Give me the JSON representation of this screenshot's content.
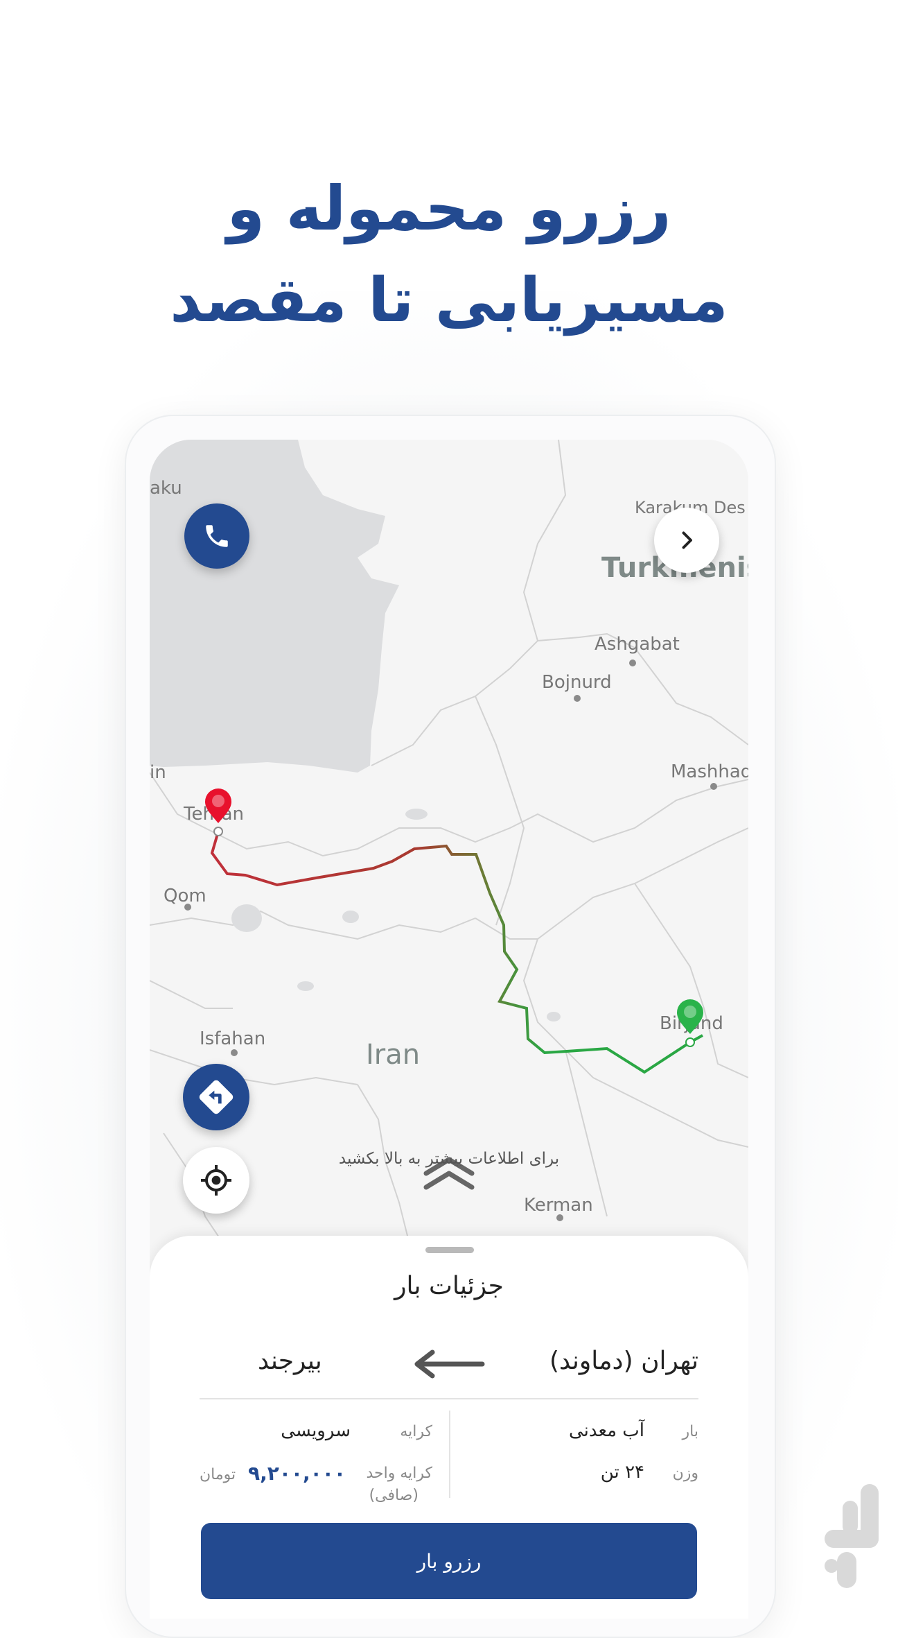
{
  "headline": {
    "line1": "رزرو محموله و",
    "line2": "مسیریابی تا مقصد"
  },
  "colors": {
    "brand_blue": "#234a90",
    "origin_pin": "#e8112d",
    "dest_pin": "#2ab34a",
    "route_start": "#b03333",
    "route_end": "#2aa744",
    "water": "#dcdddf",
    "land": "#f5f5f5"
  },
  "map": {
    "labels": {
      "baku": "aku",
      "karakum": "Karakum Des",
      "turkmenistan": "Turkmenis",
      "ashgabat": "Ashgabat",
      "bojnurd": "Bojnurd",
      "mashhad": "Mashhad",
      "tehran": "Tehran",
      "qom": "Qom",
      "isfahan": "Isfahan",
      "iran": "Iran",
      "birjand": "Birjand",
      "kerman": "Kerman",
      "edge_in": "in"
    },
    "buttons": {
      "call_icon": "phone-icon",
      "next_icon": "chevron-right-icon",
      "directions_icon": "turn-left-icon",
      "locate_icon": "crosshair-icon"
    },
    "pull_hint": "برای اطلاعات بیشتر به بالا بکشید"
  },
  "sheet": {
    "title": "جزئیات بار",
    "origin": "تهران (دماوند)",
    "destination": "بیرجند",
    "cargo_label": "بار",
    "cargo_value": "آب معدنی",
    "weight_label": "وزن",
    "weight_value": "۲۴ تن",
    "fare_label": "کرایه",
    "fare_value": "سرویسی",
    "unit_fare_label": "کرایه واحد",
    "unit_fare_sub": "(صافی)",
    "unit_fare_value": "۹,۲۰۰,۰۰۰",
    "currency": "تومان",
    "reserve_button": "رزرو بار"
  }
}
